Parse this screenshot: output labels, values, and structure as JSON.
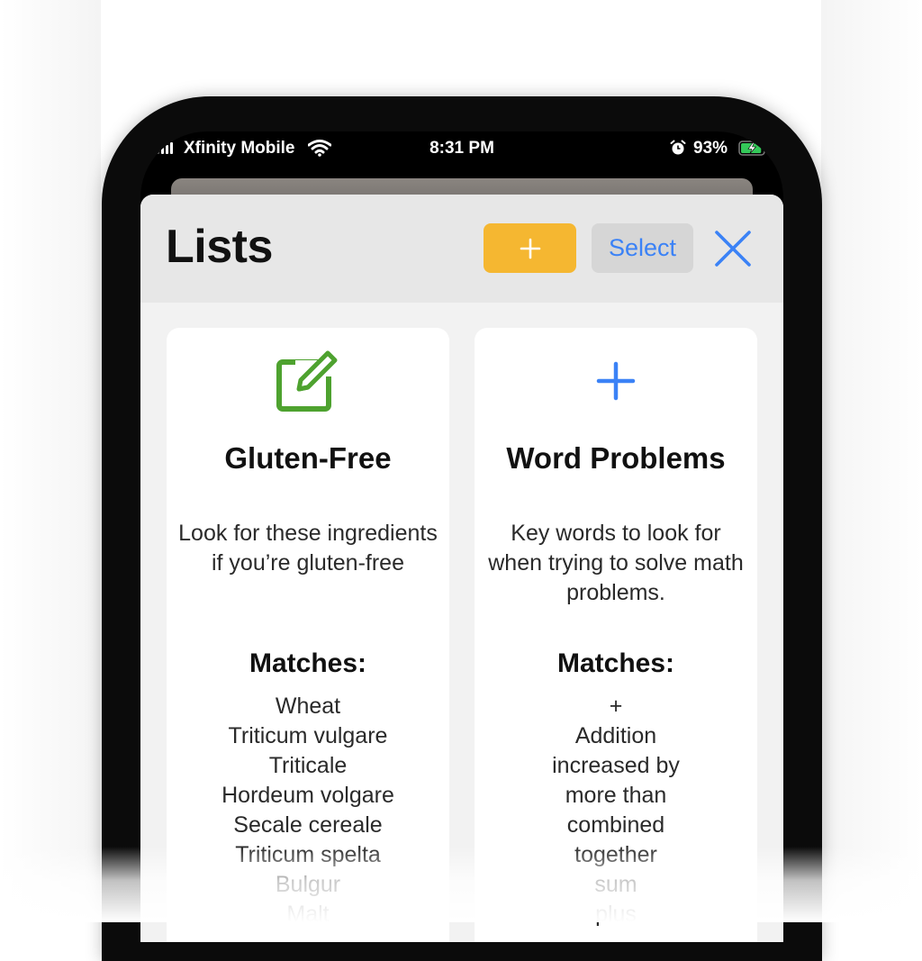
{
  "status_bar": {
    "carrier": "Xfinity Mobile",
    "time": "8:31 PM",
    "battery_percent": "93%",
    "battery_level": 0.93,
    "icons": [
      "signal-icon",
      "wifi-icon",
      "alarm-icon",
      "battery-charging-icon"
    ]
  },
  "header": {
    "title": "Lists",
    "add_label": "+",
    "select_label": "Select",
    "close_icon": "close-icon"
  },
  "lists": [
    {
      "icon": "edit-icon",
      "title": "Gluten-Free",
      "description": "Look for these ingredients if you’re gluten-free",
      "matches_label": "Matches:",
      "matches": [
        "Wheat",
        "Triticum vulgare",
        "Triticale",
        "Hordeum volgare",
        "Secale cereale",
        "Triticum spelta",
        "Bulgur",
        "Malt"
      ]
    },
    {
      "icon": "plus-icon",
      "title": "Word Problems",
      "description": "Key words to look for when trying to solve math problems.",
      "matches_label": "Matches:",
      "matches": [
        "+",
        "Addition",
        "increased by",
        "more than",
        "combined",
        "together",
        "sum",
        "plus"
      ]
    }
  ],
  "colors": {
    "accent_blue": "#3b82f6",
    "add_button": "#f5b731",
    "edit_icon_green": "#4ea22f"
  }
}
